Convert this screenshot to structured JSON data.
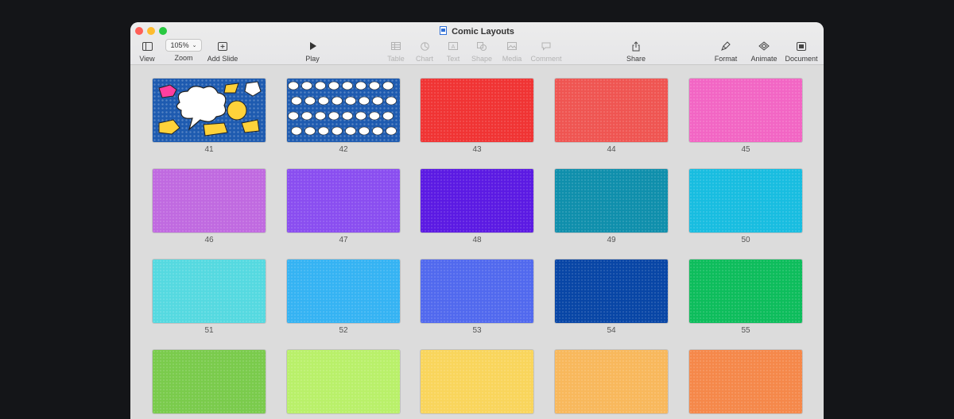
{
  "window": {
    "title": "Comic Layouts",
    "traffic_colors": [
      "#ff5f57",
      "#febc2e",
      "#28c840"
    ]
  },
  "toolbar": {
    "view_label": "View",
    "zoom_value": "105%",
    "zoom_label": "Zoom",
    "add_slide_label": "Add Slide",
    "play_label": "Play",
    "table_label": "Table",
    "chart_label": "Chart",
    "text_label": "Text",
    "shape_label": "Shape",
    "media_label": "Media",
    "comment_label": "Comment",
    "share_label": "Share",
    "format_label": "Format",
    "animate_label": "Animate",
    "document_label": "Document"
  },
  "slides": [
    {
      "number": "41",
      "color": "#1e5bb0",
      "kind": "comic-1"
    },
    {
      "number": "42",
      "color": "#1e5bb0",
      "kind": "comic-2"
    },
    {
      "number": "43",
      "color": "#f03434"
    },
    {
      "number": "44",
      "color": "#ef5552"
    },
    {
      "number": "45",
      "color": "#f266c4"
    },
    {
      "number": "46",
      "color": "#c06ae0"
    },
    {
      "number": "47",
      "color": "#8a4ef0"
    },
    {
      "number": "48",
      "color": "#5b1ae3"
    },
    {
      "number": "49",
      "color": "#0f8fac"
    },
    {
      "number": "50",
      "color": "#18bde0"
    },
    {
      "number": "51",
      "color": "#55d9e0"
    },
    {
      "number": "52",
      "color": "#35b3f3"
    },
    {
      "number": "53",
      "color": "#5169ee"
    },
    {
      "number": "54",
      "color": "#0846a6"
    },
    {
      "number": "55",
      "color": "#0dbd5c"
    },
    {
      "number": "",
      "color": "#7acb4c"
    },
    {
      "number": "",
      "color": "#b9f06a"
    },
    {
      "number": "",
      "color": "#f9d55c"
    },
    {
      "number": "",
      "color": "#f8b85c"
    },
    {
      "number": "",
      "color": "#f5884a"
    }
  ]
}
